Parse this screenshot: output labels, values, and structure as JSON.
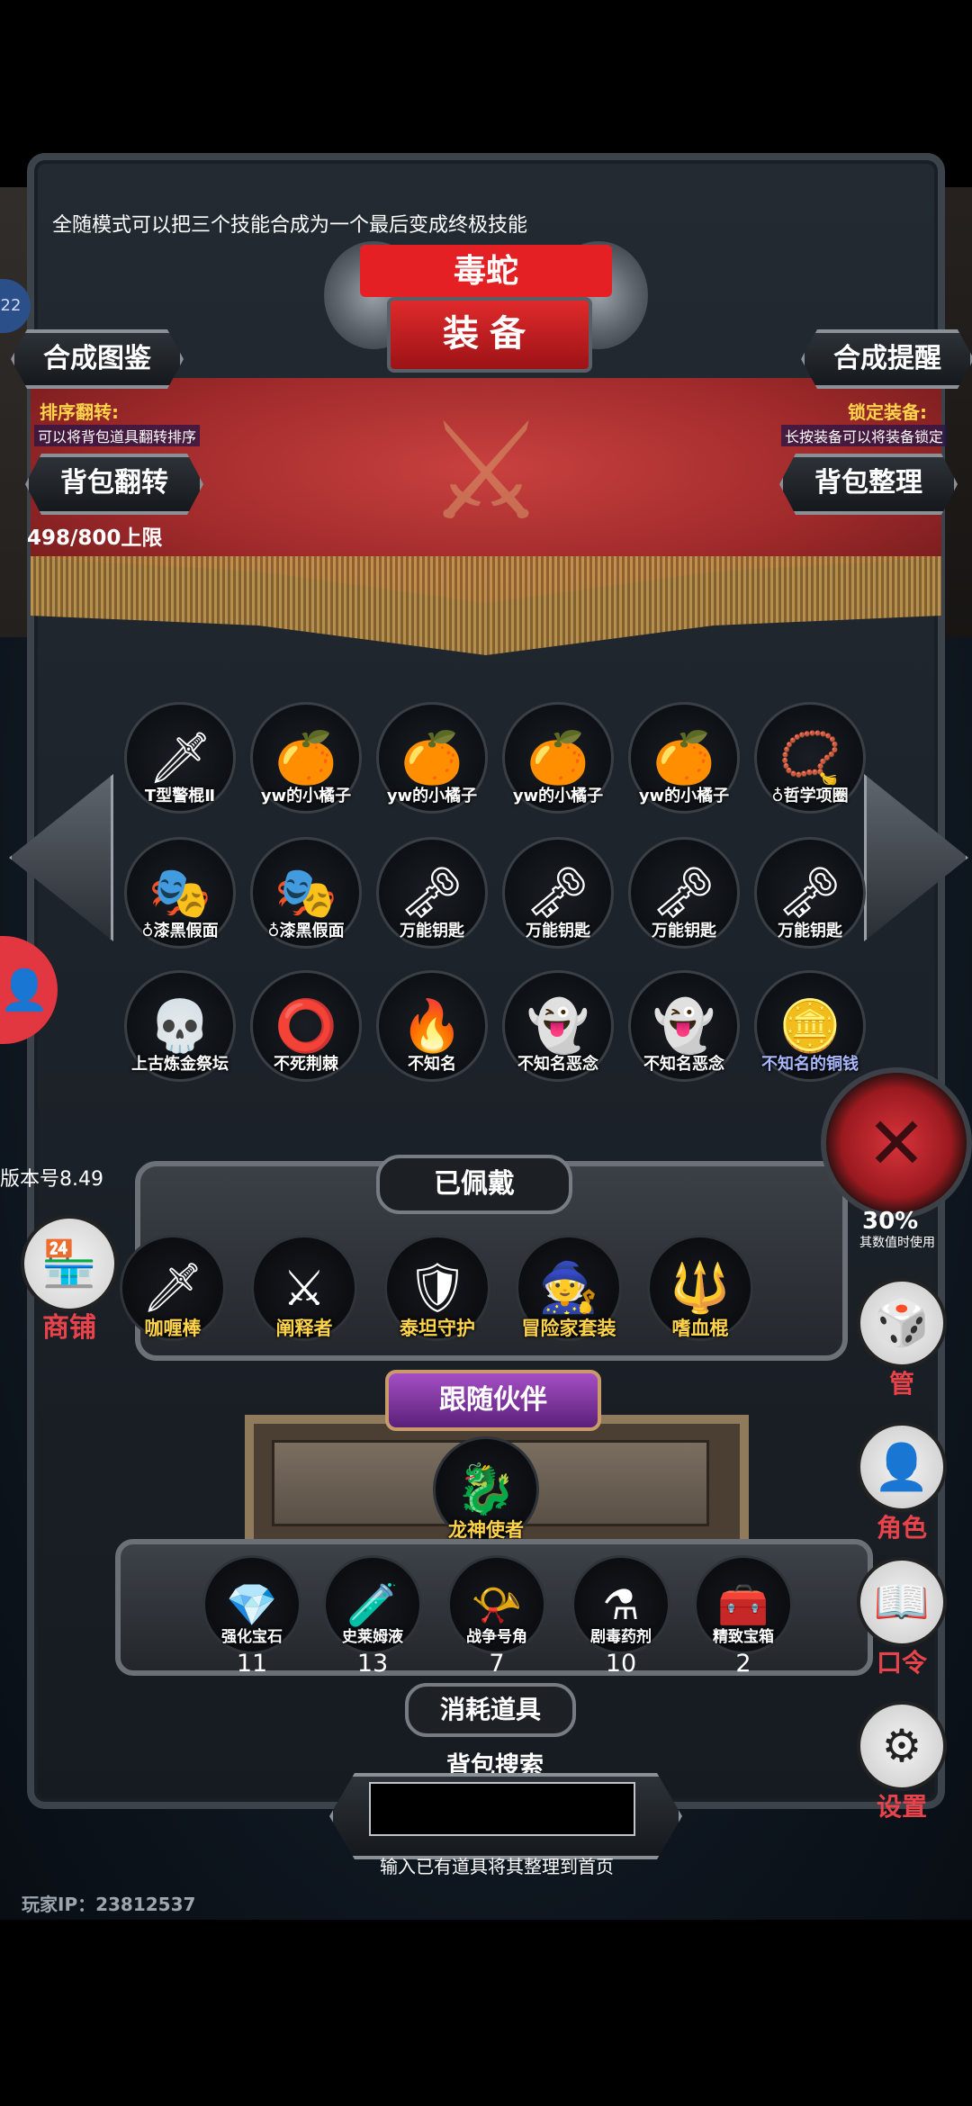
{
  "tip": "全随模式可以把三个技能合成为一个最后变成终极技能",
  "header": {
    "subtitle": "毒蛇",
    "title": "装备",
    "left_button": "合成图鉴",
    "right_button": "合成提醒"
  },
  "sort": {
    "label": "排序翻转:",
    "desc": "可以将背包道具翻转排序",
    "button": "背包翻转"
  },
  "lock": {
    "label": "锁定装备:",
    "desc": "长按装备可以将装备锁定",
    "button": "背包整理"
  },
  "capacity": "498/800上限",
  "side_badge": "22",
  "inventory": [
    {
      "name": "T型警棍Ⅱ",
      "icon": "baton-icon",
      "glyph": "🗡"
    },
    {
      "name": "yw的小橘子",
      "icon": "orange-icon",
      "glyph": "🍊"
    },
    {
      "name": "yw的小橘子",
      "icon": "orange-icon",
      "glyph": "🍊"
    },
    {
      "name": "yw的小橘子",
      "icon": "orange-icon",
      "glyph": "🍊"
    },
    {
      "name": "yw的小橘子",
      "icon": "orange-icon",
      "glyph": "🍊"
    },
    {
      "name": "♁哲学项圈",
      "icon": "necklace-icon",
      "glyph": "📿"
    },
    {
      "name": "♁漆黑假面",
      "icon": "mask-icon",
      "glyph": "🎭"
    },
    {
      "name": "♁漆黑假面",
      "icon": "mask-icon",
      "glyph": "🎭"
    },
    {
      "name": "万能钥匙",
      "icon": "key-icon",
      "glyph": "🗝"
    },
    {
      "name": "万能钥匙",
      "icon": "key-icon",
      "glyph": "🗝"
    },
    {
      "name": "万能钥匙",
      "icon": "key-icon",
      "glyph": "🗝"
    },
    {
      "name": "万能钥匙",
      "icon": "key-icon",
      "glyph": "🗝"
    },
    {
      "name": "上古炼金祭坛",
      "icon": "skull-altar-icon",
      "glyph": "💀"
    },
    {
      "name": "不死荆棘",
      "icon": "thorn-ring-icon",
      "glyph": "⭕"
    },
    {
      "name": "不知名",
      "icon": "flame-icon",
      "glyph": "🔥"
    },
    {
      "name": "不知名恶念",
      "icon": "ghost-icon",
      "glyph": "👻"
    },
    {
      "name": "不知名恶念",
      "icon": "ghost-icon",
      "glyph": "👻"
    },
    {
      "name": "不知名的铜钱",
      "icon": "coin-icon",
      "glyph": "🪙"
    }
  ],
  "version": "版本号8.49",
  "worn": {
    "title": "已佩戴",
    "items": [
      {
        "name": "咖喱棒",
        "icon": "golden-sword-icon",
        "glyph": "🗡"
      },
      {
        "name": "阐释者",
        "icon": "black-sword-icon",
        "glyph": "⚔"
      },
      {
        "name": "泰坦守护",
        "icon": "titan-armor-icon",
        "glyph": "🛡"
      },
      {
        "name": "冒险家套装",
        "icon": "adventurer-icon",
        "glyph": "🧙"
      },
      {
        "name": "嗜血棍",
        "icon": "blood-staff-icon",
        "glyph": "🔱"
      }
    ]
  },
  "companion": {
    "title": "跟随伙伴",
    "name": "龙神使者",
    "glyph": "🐉"
  },
  "consumables": {
    "title": "消耗道具",
    "items": [
      {
        "name": "强化宝石",
        "count": "11",
        "icon": "gem-icon",
        "glyph": "💎"
      },
      {
        "name": "史莱姆液",
        "count": "13",
        "icon": "potion-icon",
        "glyph": "🧪"
      },
      {
        "name": "战争号角",
        "count": "7",
        "icon": "horn-icon",
        "glyph": "📯"
      },
      {
        "name": "剧毒药剂",
        "count": "10",
        "icon": "poison-icon",
        "glyph": "⚗"
      },
      {
        "name": "精致宝箱",
        "count": "2",
        "icon": "chest-icon",
        "glyph": "🧰"
      }
    ]
  },
  "search": {
    "label": "背包搜索",
    "value": "",
    "hint": "输入已有道具将其整理到首页"
  },
  "player_id": "玩家IP：23812537",
  "right_menu": [
    {
      "label": "管",
      "icon": "dice-icon",
      "glyph": "🎲"
    },
    {
      "label": "角色",
      "icon": "hood-icon",
      "glyph": "👤"
    },
    {
      "label": "口令",
      "icon": "book-icon",
      "glyph": "📖"
    },
    {
      "label": "设置",
      "icon": "gear-icon",
      "glyph": "⚙"
    }
  ],
  "usage": {
    "value": "30%",
    "text": "其数值时使用"
  },
  "shop": {
    "label": "商铺",
    "glyph": "🏪"
  },
  "colors": {
    "accent_red": "#e52024",
    "gold": "#ffd34a",
    "menu_red": "#e8434a",
    "purple": "#8a3bb0"
  }
}
